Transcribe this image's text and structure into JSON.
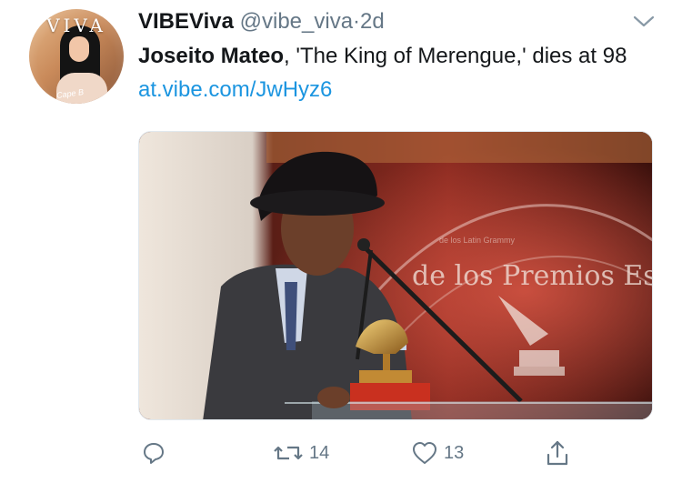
{
  "tweet": {
    "display_name": "VIBEViva",
    "handle": "@vibe_viva",
    "separator": "·",
    "time": "2d",
    "text_bold": "Joseito Mateo",
    "text_rest": ", 'The King of Merengue,' dies at 98 ",
    "link": "at.vibe.com/JwHyz6",
    "avatar": {
      "logo_text": "VIVA"
    },
    "media": {
      "banner_text": "de los Premios Esp",
      "banner_subtext": "de los Latin Grammy"
    }
  },
  "actions": {
    "reply": {
      "icon": "reply-icon",
      "count": ""
    },
    "retweet": {
      "icon": "retweet-icon",
      "count": "14"
    },
    "like": {
      "icon": "heart-icon",
      "count": "13"
    },
    "share": {
      "icon": "share-icon"
    }
  },
  "colors": {
    "link": "#1b95e0",
    "muted": "#657786",
    "text": "#14171a"
  }
}
